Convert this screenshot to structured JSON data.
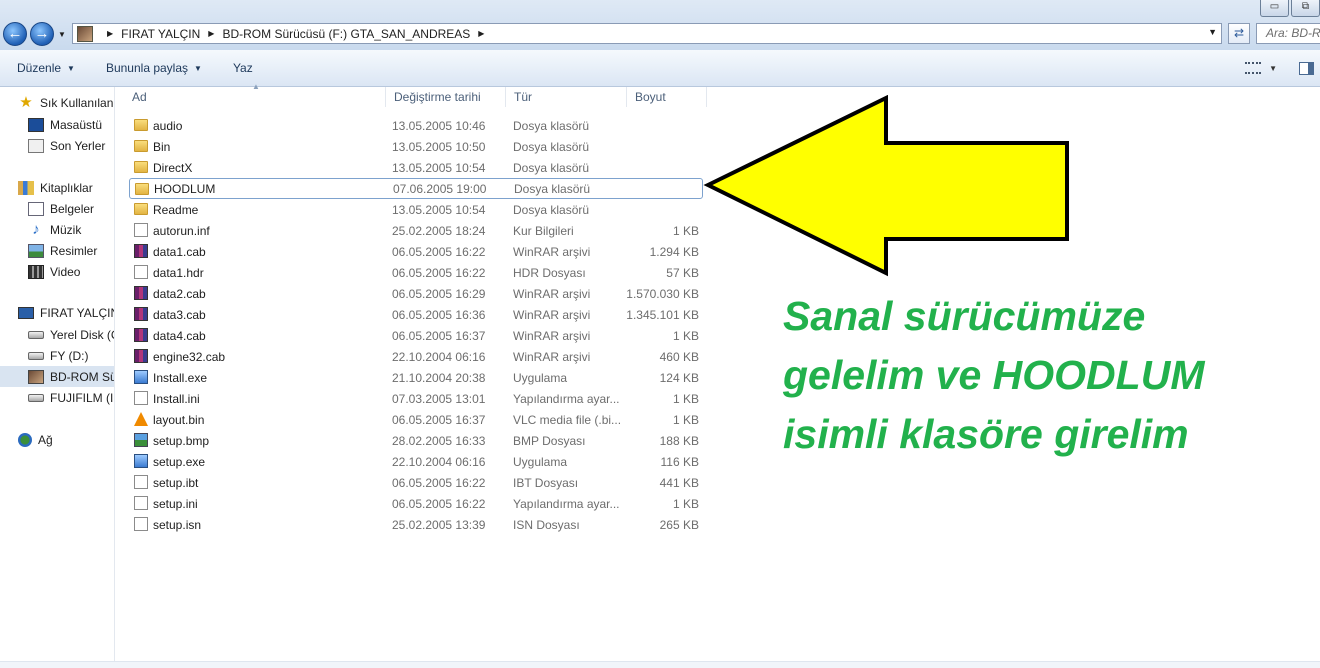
{
  "window": {
    "minimize_label": "▭",
    "maximize_label": "⧉"
  },
  "address": {
    "crumbs": [
      "FIRAT YALÇIN",
      "BD-ROM Sürücüsü (F:) GTA_SAN_ANDREAS"
    ],
    "search_placeholder": "Ara: BD-R"
  },
  "toolbar": {
    "organize": "Düzenle",
    "share": "Bununla paylaş",
    "burn": "Yaz"
  },
  "sidebar": {
    "items": [
      {
        "label": "Sık Kullanılanlar",
        "icon": "star-icon",
        "top": 0
      },
      {
        "label": "Masaüstü",
        "icon": "desktop-icon"
      },
      {
        "label": "Son Yerler",
        "icon": "recent-places-icon"
      },
      {
        "label": "Kitaplıklar",
        "icon": "library-icon"
      },
      {
        "label": "Belgeler",
        "icon": "documents-icon"
      },
      {
        "label": "Müzik",
        "icon": "music-icon"
      },
      {
        "label": "Resimler",
        "icon": "pictures-icon"
      },
      {
        "label": "Video",
        "icon": "video-icon"
      },
      {
        "label": "FIRAT YALÇIN",
        "icon": "computer-icon"
      },
      {
        "label": "Yerel Disk (C:)",
        "icon": "drive-icon"
      },
      {
        "label": "FY (D:)",
        "icon": "drive-icon"
      },
      {
        "label": "BD-ROM Sürücüsü (F:)",
        "icon": "bd-rom-icon"
      },
      {
        "label": "FUJIFILM (I:)",
        "icon": "drive-icon"
      },
      {
        "label": "Ağ",
        "icon": "network-icon"
      }
    ]
  },
  "columns": {
    "name": "Ad",
    "date": "Değiştirme tarihi",
    "type": "Tür",
    "size": "Boyut"
  },
  "files": [
    {
      "name": "audio",
      "date": "13.05.2005 10:46",
      "type": "Dosya klasörü",
      "size": "",
      "icon": "folder"
    },
    {
      "name": "Bin",
      "date": "13.05.2005 10:50",
      "type": "Dosya klasörü",
      "size": "",
      "icon": "folder"
    },
    {
      "name": "DirectX",
      "date": "13.05.2005 10:54",
      "type": "Dosya klasörü",
      "size": "",
      "icon": "folder"
    },
    {
      "name": "HOODLUM",
      "date": "07.06.2005 19:00",
      "type": "Dosya klasörü",
      "size": "",
      "icon": "folder"
    },
    {
      "name": "Readme",
      "date": "13.05.2005 10:54",
      "type": "Dosya klasörü",
      "size": "",
      "icon": "folder"
    },
    {
      "name": "autorun.inf",
      "date": "25.02.2005 18:24",
      "type": "Kur Bilgileri",
      "size": "1 KB",
      "icon": "inf"
    },
    {
      "name": "data1.cab",
      "date": "06.05.2005 16:22",
      "type": "WinRAR arşivi",
      "size": "1.294 KB",
      "icon": "rar"
    },
    {
      "name": "data1.hdr",
      "date": "06.05.2005 16:22",
      "type": "HDR Dosyası",
      "size": "57 KB",
      "icon": "file"
    },
    {
      "name": "data2.cab",
      "date": "06.05.2005 16:29",
      "type": "WinRAR arşivi",
      "size": "1.570.030 KB",
      "icon": "rar"
    },
    {
      "name": "data3.cab",
      "date": "06.05.2005 16:36",
      "type": "WinRAR arşivi",
      "size": "1.345.101 KB",
      "icon": "rar"
    },
    {
      "name": "data4.cab",
      "date": "06.05.2005 16:37",
      "type": "WinRAR arşivi",
      "size": "1 KB",
      "icon": "rar"
    },
    {
      "name": "engine32.cab",
      "date": "22.10.2004 06:16",
      "type": "WinRAR arşivi",
      "size": "460 KB",
      "icon": "rar"
    },
    {
      "name": "Install.exe",
      "date": "21.10.2004 20:38",
      "type": "Uygulama",
      "size": "124 KB",
      "icon": "exe"
    },
    {
      "name": "Install.ini",
      "date": "07.03.2005 13:01",
      "type": "Yapılandırma ayar...",
      "size": "1 KB",
      "icon": "gear"
    },
    {
      "name": "layout.bin",
      "date": "06.05.2005 16:37",
      "type": "VLC media file (.bi...",
      "size": "1 KB",
      "icon": "vlc"
    },
    {
      "name": "setup.bmp",
      "date": "28.02.2005 16:33",
      "type": "BMP Dosyası",
      "size": "188 KB",
      "icon": "bmp"
    },
    {
      "name": "setup.exe",
      "date": "22.10.2004 06:16",
      "type": "Uygulama",
      "size": "116 KB",
      "icon": "exe"
    },
    {
      "name": "setup.ibt",
      "date": "06.05.2005 16:22",
      "type": "IBT Dosyası",
      "size": "441 KB",
      "icon": "file"
    },
    {
      "name": "setup.ini",
      "date": "06.05.2005 16:22",
      "type": "Yapılandırma ayar...",
      "size": "1 KB",
      "icon": "gear"
    },
    {
      "name": "setup.isn",
      "date": "25.02.2005 13:39",
      "type": "ISN Dosyası",
      "size": "265 KB",
      "icon": "file"
    }
  ],
  "annotation": {
    "lines": [
      "Sanal sürücümüze",
      "gelelim ve HOODLUM",
      "isimli klasöre girelim"
    ],
    "text_color": "#22b14c",
    "arrow_color": "#ffff00"
  }
}
